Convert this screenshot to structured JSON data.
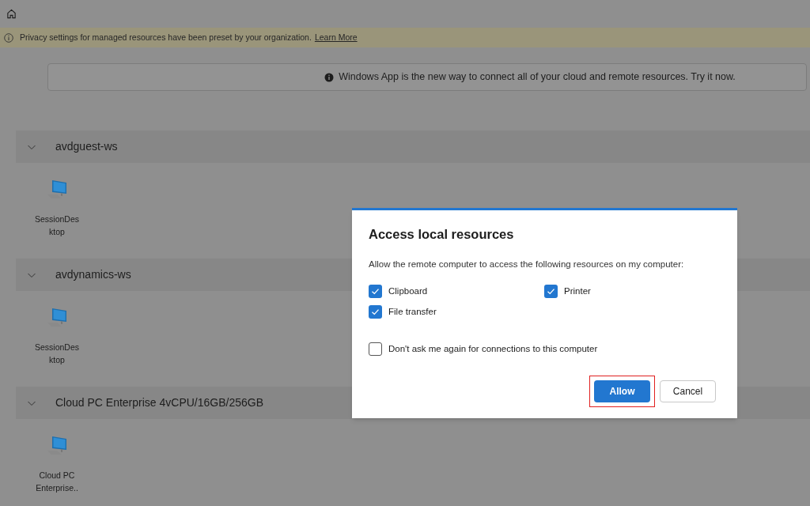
{
  "banner": {
    "text": "Privacy settings for managed resources have been preset by your organization.",
    "link": "Learn More"
  },
  "notice": {
    "text": "Windows App is the new way to connect all of your cloud and remote resources. Try it now."
  },
  "groups": [
    {
      "name": "avdguest-ws",
      "expanded": true,
      "items": [
        {
          "label_lines": [
            "SessionDes",
            "ktop"
          ]
        }
      ]
    },
    {
      "name": "avdynamics-ws",
      "expanded": true,
      "items": [
        {
          "label_lines": [
            "SessionDes",
            "ktop"
          ]
        }
      ]
    },
    {
      "name": "Cloud PC Enterprise 4vCPU/16GB/256GB",
      "expanded": true,
      "items": [
        {
          "label_lines": [
            "Cloud PC",
            "Enterprise.."
          ]
        }
      ]
    }
  ],
  "dialog": {
    "title": "Access local resources",
    "description": "Allow the remote computer to access the following resources on my computer:",
    "resources": [
      {
        "label": "Clipboard",
        "checked": true
      },
      {
        "label": "Printer",
        "checked": true
      },
      {
        "label": "File transfer",
        "checked": true
      }
    ],
    "dont_ask": {
      "label": "Don't ask me again for connections to this computer",
      "checked": false
    },
    "buttons": [
      {
        "label": "Allow",
        "kind": "primary",
        "highlighted": true
      },
      {
        "label": "Cancel",
        "kind": "secondary",
        "highlighted": false
      }
    ]
  }
}
